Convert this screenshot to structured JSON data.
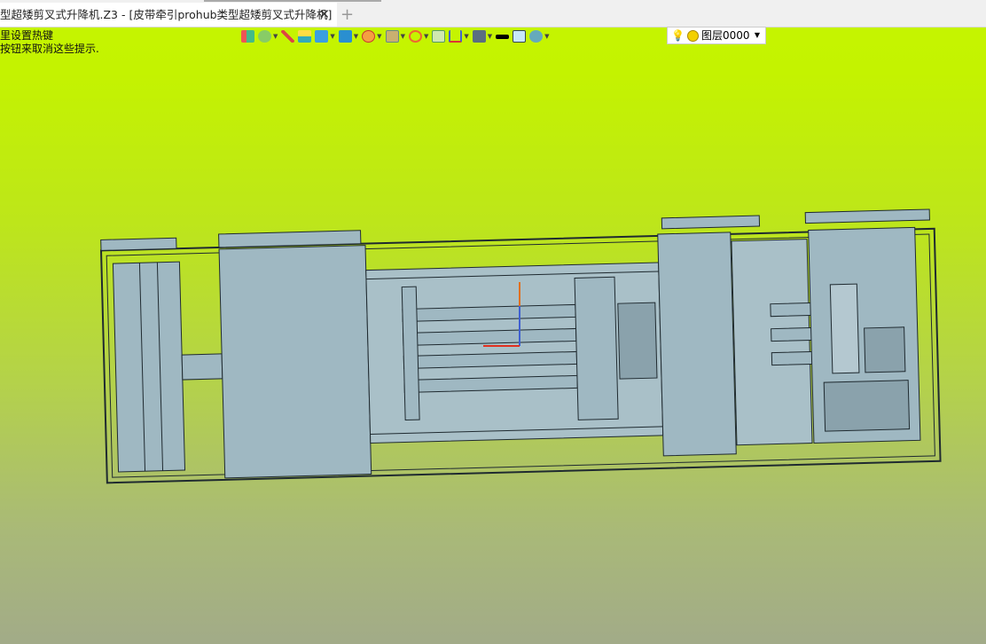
{
  "tab": {
    "title": "型超矮剪叉式升降机.Z3 - [皮带牵引prohub类型超矮剪叉式升降机]",
    "close": "✕",
    "new_tab": "+"
  },
  "hint": {
    "line1": "里设置热键",
    "line2": "按钮来取消这些提示."
  },
  "toolbar": {
    "icons": [
      "exit-icon",
      "stack-icon",
      "pen-icon",
      "box-face-icon",
      "cube-icon",
      "view-cube-icon",
      "render-icon",
      "texture-icon",
      "target-icon",
      "frame-icon",
      "dimension-icon",
      "monitor-icon",
      "line-color-icon",
      "fill-color-icon",
      "layers-icon"
    ]
  },
  "layer": {
    "value": "图层0000"
  },
  "colors": {
    "bg_top": "#c6f500",
    "bg_bottom": "#a2ab88",
    "model": "#9fb8c2",
    "edge": "#1f2a30"
  }
}
